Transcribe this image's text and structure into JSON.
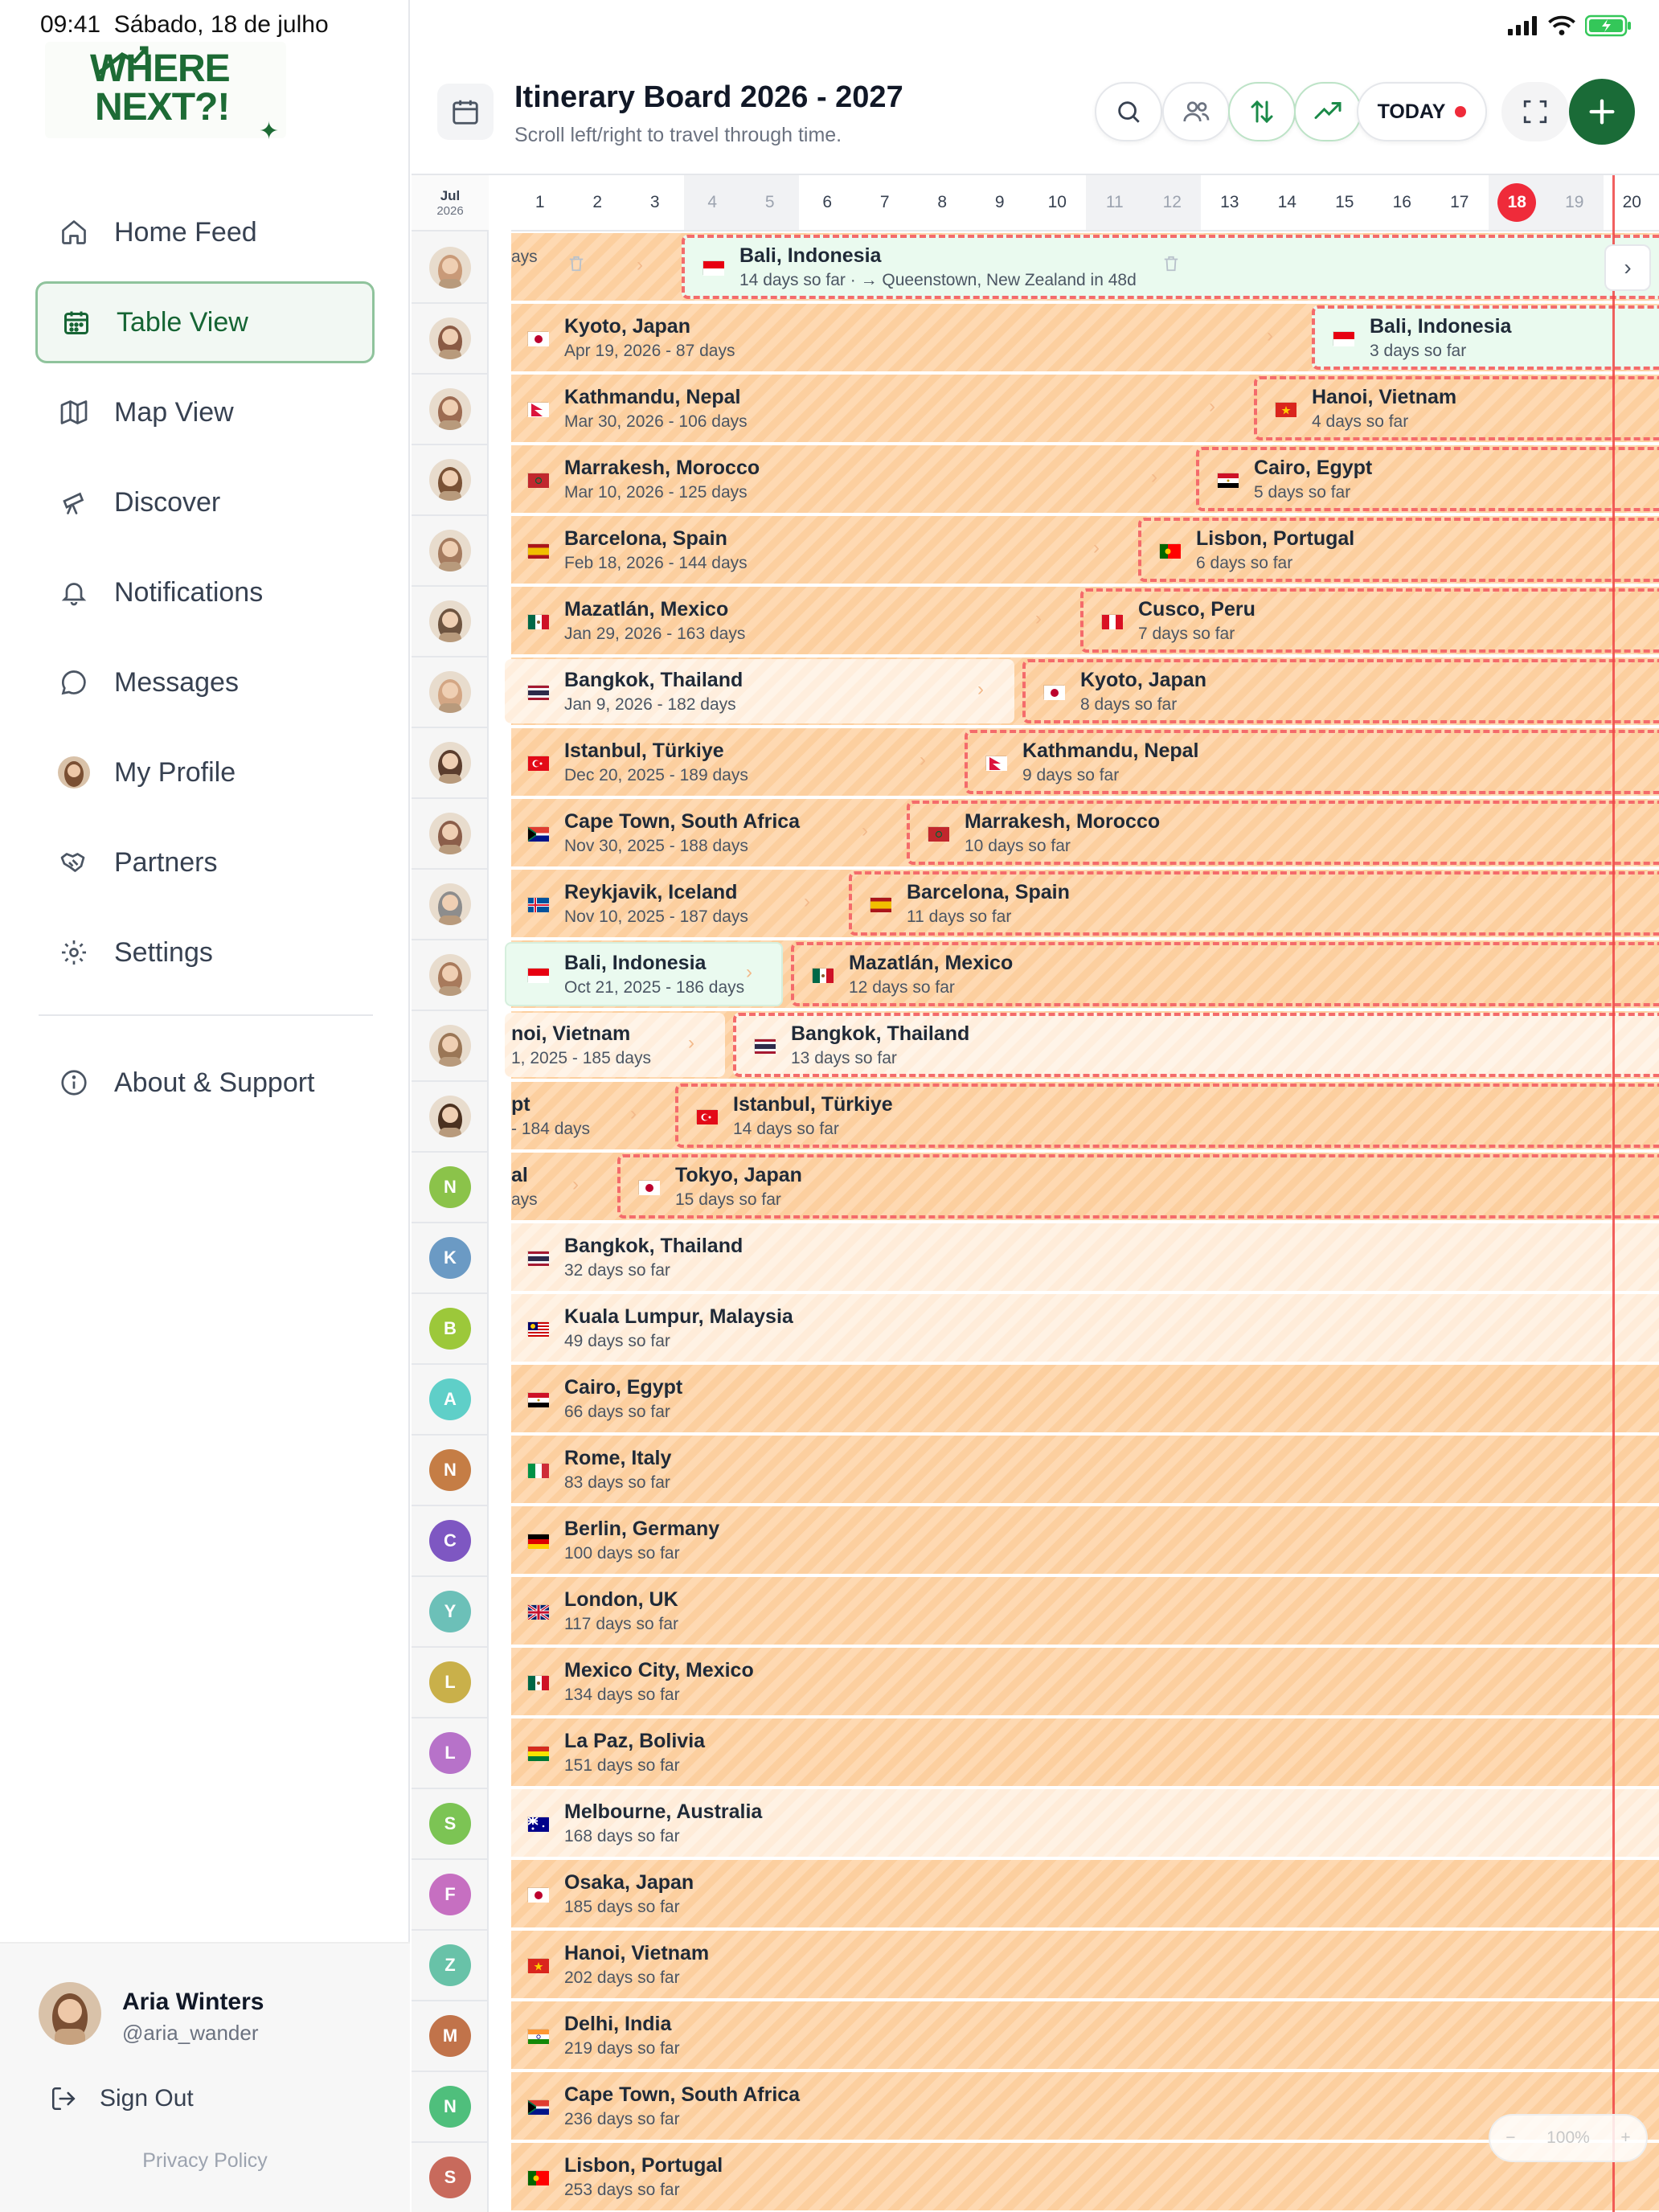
{
  "status": {
    "time": "09:41",
    "date": "Sábado, 18 de julho"
  },
  "logo": {
    "line1": "WHERE",
    "line2": "NEXT?!"
  },
  "nav": [
    {
      "label": "Home Feed",
      "icon": "home-icon",
      "active": false
    },
    {
      "label": "Table View",
      "icon": "calendar-icon",
      "active": true
    },
    {
      "label": "Map View",
      "icon": "map-icon",
      "active": false
    },
    {
      "label": "Discover",
      "icon": "telescope-icon",
      "active": false
    },
    {
      "label": "Notifications",
      "icon": "bell-icon",
      "active": false
    },
    {
      "label": "Messages",
      "icon": "chat-icon",
      "active": false
    },
    {
      "label": "My Profile",
      "icon": "avatar",
      "active": false
    },
    {
      "label": "Partners",
      "icon": "handshake-icon",
      "active": false
    },
    {
      "label": "Settings",
      "icon": "gear-icon",
      "active": false
    }
  ],
  "about": "About & Support",
  "user": {
    "name": "Aria Winters",
    "handle": "@aria_wander"
  },
  "signout": "Sign Out",
  "privacy": "Privacy Policy",
  "header": {
    "title": "Itinerary Board 2026 - 2027",
    "subtitle": "Scroll left/right to travel through time.",
    "today_label": "TODAY"
  },
  "timeline": {
    "month": "Jul",
    "year": "2026",
    "days": [
      "1",
      "2",
      "3",
      "4",
      "5",
      "6",
      "7",
      "8",
      "9",
      "10",
      "11",
      "12",
      "13",
      "14",
      "15",
      "16",
      "17",
      "18",
      "19",
      "20"
    ],
    "weekend_days": [
      "4",
      "5",
      "11",
      "12",
      "18",
      "19"
    ],
    "today": "18"
  },
  "colors": {
    "brand": "#1a6b37",
    "today": "#ef2b3a",
    "stay": "#fed9b2",
    "dashed": "#f46b6b",
    "mint": "#eafaef"
  },
  "avatars": [
    {
      "type": "photo",
      "tone": "#c99a78"
    },
    {
      "type": "photo",
      "tone": "#8a5a44"
    },
    {
      "type": "photo",
      "tone": "#9c6b52"
    },
    {
      "type": "photo",
      "tone": "#7a5236"
    },
    {
      "type": "photo",
      "tone": "#a57b5f"
    },
    {
      "type": "photo",
      "tone": "#6e5440"
    },
    {
      "type": "photo",
      "tone": "#d3a684"
    },
    {
      "type": "photo",
      "tone": "#5b3d2d"
    },
    {
      "type": "photo",
      "tone": "#8b5e4a"
    },
    {
      "type": "photo",
      "tone": "#8d8d8d"
    },
    {
      "type": "photo",
      "tone": "#a87a5c"
    },
    {
      "type": "photo",
      "tone": "#9a7656"
    },
    {
      "type": "photo",
      "tone": "#4b3120"
    },
    {
      "type": "letter",
      "letter": "N",
      "color": "#8bc34a"
    },
    {
      "type": "letter",
      "letter": "K",
      "color": "#6b9ac4"
    },
    {
      "type": "letter",
      "letter": "B",
      "color": "#9cc83a"
    },
    {
      "type": "letter",
      "letter": "A",
      "color": "#5fcfc8"
    },
    {
      "type": "letter",
      "letter": "N",
      "color": "#c57d45"
    },
    {
      "type": "letter",
      "letter": "C",
      "color": "#7e57c2"
    },
    {
      "type": "letter",
      "letter": "Y",
      "color": "#6cc0b8"
    },
    {
      "type": "letter",
      "letter": "L",
      "color": "#c9b04a"
    },
    {
      "type": "letter",
      "letter": "L",
      "color": "#b772c9"
    },
    {
      "type": "letter",
      "letter": "S",
      "color": "#7cc454"
    },
    {
      "type": "letter",
      "letter": "F",
      "color": "#c66fc1"
    },
    {
      "type": "letter",
      "letter": "Z",
      "color": "#68c2a8"
    },
    {
      "type": "letter",
      "letter": "M",
      "color": "#c1734a"
    },
    {
      "type": "letter",
      "letter": "N",
      "color": "#4fbf7c"
    },
    {
      "type": "letter",
      "letter": "S",
      "color": "#c86a5c"
    }
  ],
  "rows": [
    {
      "prev": {
        "title": "",
        "sub": "ays"
      },
      "cur": {
        "title": "Bali, Indonesia",
        "sub": "14 days so far · → Queenstown, New Zealand in 48d",
        "flag": "id"
      },
      "mint": true
    },
    {
      "prev": {
        "title": "Kyoto, Japan",
        "sub": "Apr 19, 2026 - 87 days",
        "flag": "jp"
      },
      "cur": {
        "title": "Bali, Indonesia",
        "sub": "3 days so far",
        "flag": "id"
      },
      "mint": true
    },
    {
      "prev": {
        "title": "Kathmandu, Nepal",
        "sub": "Mar 30, 2026 - 106 days",
        "flag": "np"
      },
      "cur": {
        "title": "Hanoi, Vietnam",
        "sub": "4 days so far",
        "flag": "vn"
      }
    },
    {
      "prev": {
        "title": "Marrakesh, Morocco",
        "sub": "Mar 10, 2026 - 125 days",
        "flag": "ma"
      },
      "cur": {
        "title": "Cairo, Egypt",
        "sub": "5 days so far",
        "flag": "eg"
      }
    },
    {
      "prev": {
        "title": "Barcelona, Spain",
        "sub": "Feb 18, 2026 - 144 days",
        "flag": "es"
      },
      "cur": {
        "title": "Lisbon, Portugal",
        "sub": "6 days so far",
        "flag": "pt"
      }
    },
    {
      "prev": {
        "title": "Mazatlán, Mexico",
        "sub": "Jan 29, 2026 - 163 days",
        "flag": "mx"
      },
      "cur": {
        "title": "Cusco, Peru",
        "sub": "7 days so far",
        "flag": "pe"
      }
    },
    {
      "prev": {
        "title": "Bangkok, Thailand",
        "sub": "Jan 9, 2026 - 182 days",
        "flag": "th"
      },
      "cur": {
        "title": "Kyoto, Japan",
        "sub": "8 days so far",
        "flag": "jp"
      },
      "prev_light": true
    },
    {
      "prev": {
        "title": "Istanbul, Türkiye",
        "sub": "Dec 20, 2025 - 189 days",
        "flag": "tr"
      },
      "cur": {
        "title": "Kathmandu, Nepal",
        "sub": "9 days so far",
        "flag": "np"
      }
    },
    {
      "prev": {
        "title": "Cape Town, South Africa",
        "sub": "Nov 30, 2025 - 188 days",
        "flag": "za"
      },
      "cur": {
        "title": "Marrakesh, Morocco",
        "sub": "10 days so far",
        "flag": "ma"
      }
    },
    {
      "prev": {
        "title": "Reykjavik, Iceland",
        "sub": "Nov 10, 2025 - 187 days",
        "flag": "is"
      },
      "cur": {
        "title": "Barcelona, Spain",
        "sub": "11 days so far",
        "flag": "es"
      }
    },
    {
      "prev": {
        "title": "Bali, Indonesia",
        "sub": "Oct 21, 2025 - 186 days",
        "flag": "id"
      },
      "cur": {
        "title": "Mazatlán, Mexico",
        "sub": "12 days so far",
        "flag": "mx"
      },
      "prev_mint": true
    },
    {
      "prev": {
        "title": "noi, Vietnam",
        "sub": "1, 2025 - 185 days",
        "flag": ""
      },
      "cur": {
        "title": "Bangkok, Thailand",
        "sub": "13 days so far",
        "flag": "th"
      },
      "prev_light": true,
      "cur_light": true
    },
    {
      "prev": {
        "title": "pt",
        "sub": "- 184 days",
        "flag": ""
      },
      "cur": {
        "title": "Istanbul, Türkiye",
        "sub": "14 days so far",
        "flag": "tr"
      }
    },
    {
      "prev": {
        "title": "al",
        "sub": "ays",
        "flag": ""
      },
      "cur": {
        "title": "Tokyo, Japan",
        "sub": "15 days so far",
        "flag": "jp"
      }
    },
    {
      "cur": {
        "title": "Bangkok, Thailand",
        "sub": "32 days so far",
        "flag": "th"
      },
      "light": true
    },
    {
      "cur": {
        "title": "Kuala Lumpur, Malaysia",
        "sub": "49 days so far",
        "flag": "my"
      },
      "light": true
    },
    {
      "cur": {
        "title": "Cairo, Egypt",
        "sub": "66 days so far",
        "flag": "eg"
      }
    },
    {
      "cur": {
        "title": "Rome, Italy",
        "sub": "83 days so far",
        "flag": "it"
      }
    },
    {
      "cur": {
        "title": "Berlin, Germany",
        "sub": "100 days so far",
        "flag": "de"
      }
    },
    {
      "cur": {
        "title": "London, UK",
        "sub": "117 days so far",
        "flag": "gb"
      }
    },
    {
      "cur": {
        "title": "Mexico City, Mexico",
        "sub": "134 days so far",
        "flag": "mx"
      }
    },
    {
      "cur": {
        "title": "La Paz, Bolivia",
        "sub": "151 days so far",
        "flag": "bo"
      }
    },
    {
      "cur": {
        "title": "Melbourne, Australia",
        "sub": "168 days so far",
        "flag": "au"
      },
      "light": true
    },
    {
      "cur": {
        "title": "Osaka, Japan",
        "sub": "185 days so far",
        "flag": "jp"
      }
    },
    {
      "cur": {
        "title": "Hanoi, Vietnam",
        "sub": "202 days so far",
        "flag": "vn"
      }
    },
    {
      "cur": {
        "title": "Delhi, India",
        "sub": "219 days so far",
        "flag": "in"
      }
    },
    {
      "cur": {
        "title": "Cape Town, South Africa",
        "sub": "236 days so far",
        "flag": "za"
      }
    },
    {
      "cur": {
        "title": "Lisbon, Portugal",
        "sub": "253 days so far",
        "flag": "pt"
      }
    }
  ],
  "zoom": {
    "minus": "−",
    "value": "100%",
    "plus": "+"
  }
}
